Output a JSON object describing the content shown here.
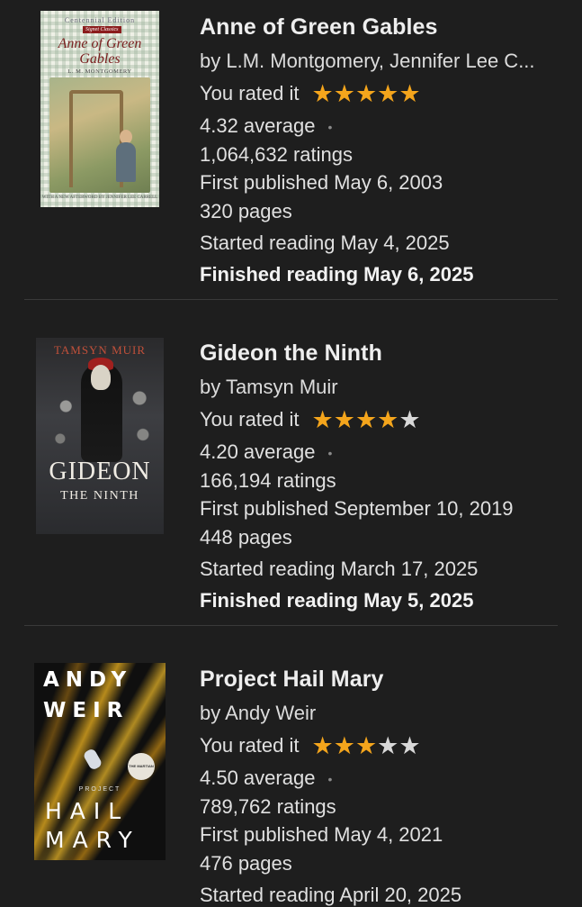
{
  "books": [
    {
      "title": "Anne of Green Gables",
      "author": "by L.M. Montgomery, Jennifer Lee C...",
      "rated_label": "You rated it",
      "rating": 5,
      "average": "4.32 average",
      "ratings_count": "1,064,632 ratings",
      "first_published": "First published May 6, 2003",
      "pages": "320 pages",
      "started": "Started reading May 4, 2025",
      "finished": "Finished reading May 6, 2025",
      "cover": {
        "edition": "Centennial Edition",
        "imprint": "Signet Classics",
        "title": "Anne of Green Gables",
        "author": "L. M. MONTGOMERY",
        "afterword": "WITH A NEW AFTERWORD BY JENNIFER LEE CARRELL"
      }
    },
    {
      "title": "Gideon the Ninth",
      "author": "by Tamsyn Muir",
      "rated_label": "You rated it",
      "rating": 4,
      "average": "4.20 average",
      "ratings_count": "166,194 ratings",
      "first_published": "First published September 10, 2019",
      "pages": "448 pages",
      "started": "Started reading March 17, 2025",
      "finished": "Finished reading May 5, 2025",
      "cover": {
        "author": "TAMSYN MUIR",
        "title": "GIDEON",
        "subtitle": "THE NINTH"
      }
    },
    {
      "title": "Project Hail Mary",
      "author": "by Andy Weir",
      "rated_label": "You rated it",
      "rating": 3,
      "average": "4.50 average",
      "ratings_count": "789,762 ratings",
      "first_published": "First published May 4, 2021",
      "pages": "476 pages",
      "started": "Started reading April 20, 2025",
      "cover": {
        "author_first": "ANDY",
        "author_last": "WEIR",
        "project": "PROJECT",
        "title_1": "HAIL",
        "title_2": "MARY",
        "badge": "THE MARTIAN"
      }
    }
  ],
  "colors": {
    "background": "#1e1e1e",
    "star_on": "#f4a51c",
    "star_off": "#d8d8d8",
    "divider": "#3a3a3a"
  },
  "icons": {
    "star": "star-icon",
    "separator_dot": "dot-icon"
  }
}
